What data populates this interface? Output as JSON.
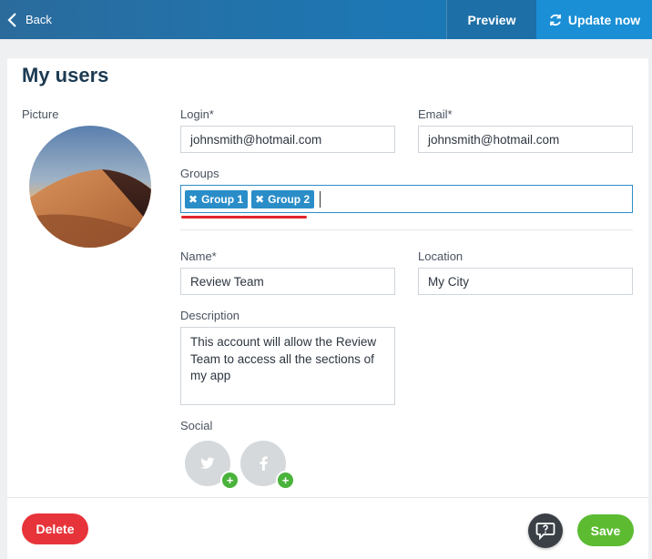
{
  "topbar": {
    "back_label": "Back",
    "preview_label": "Preview",
    "update_label": "Update now"
  },
  "page": {
    "title": "My users"
  },
  "form": {
    "picture_label": "Picture",
    "login_label": "Login*",
    "login_value": "johnsmith@hotmail.com",
    "email_label": "Email*",
    "email_value": "johnsmith@hotmail.com",
    "groups_label": "Groups",
    "groups": [
      "Group 1",
      "Group 2"
    ],
    "name_label": "Name*",
    "name_value": "Review Team",
    "location_label": "Location",
    "location_value": "My City",
    "description_label": "Description",
    "description_value": "This account will allow the Review Team to access all the sections of my app",
    "social_label": "Social",
    "social_networks": [
      "twitter-icon",
      "facebook-icon"
    ]
  },
  "footer": {
    "delete_label": "Delete",
    "save_label": "Save"
  },
  "colors": {
    "accent": "#1a8fd6",
    "delete": "#e7343a",
    "save": "#5dbb32",
    "tag": "#2a8dc8",
    "highlight": "#e4262b"
  }
}
